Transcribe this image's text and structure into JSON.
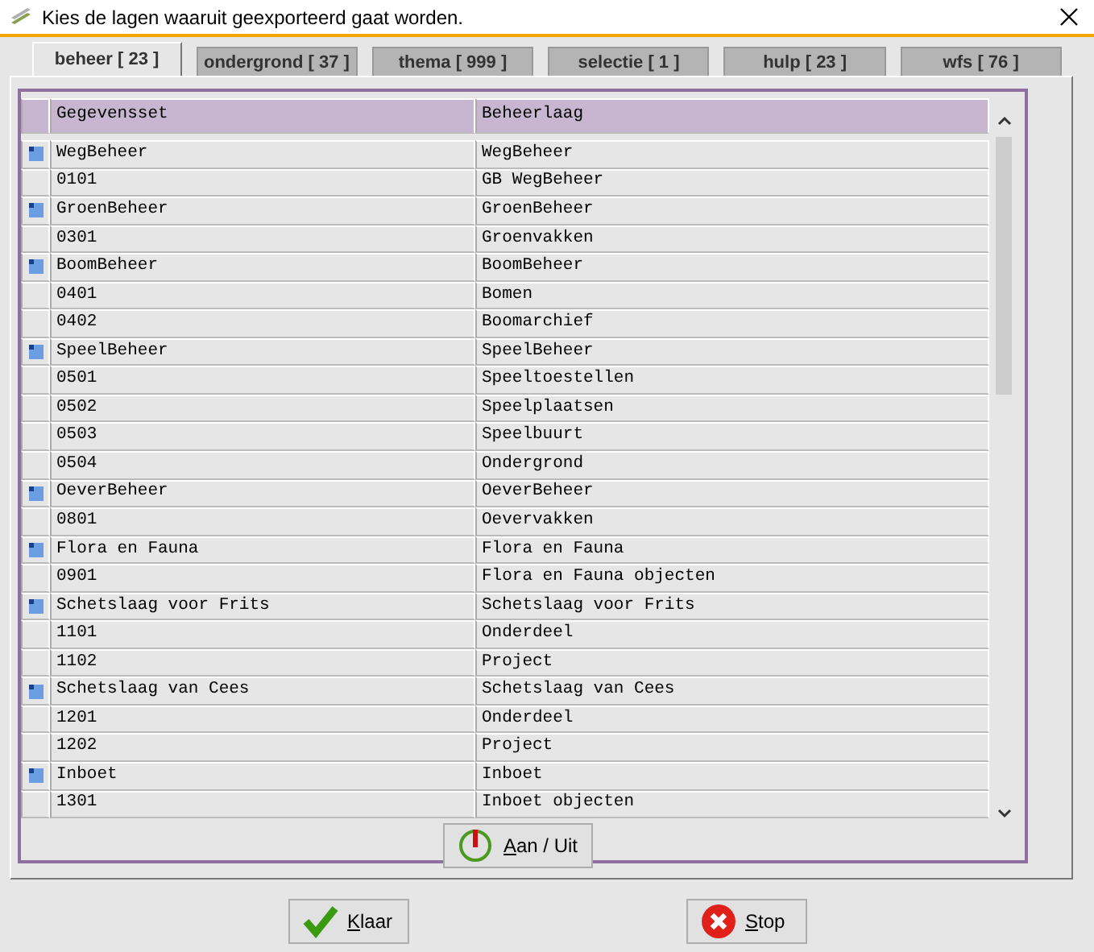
{
  "window": {
    "title": "Kies de lagen waaruit geexporteerd gaat worden."
  },
  "tabs": [
    {
      "label": "beheer [ 23 ]",
      "selected": true
    },
    {
      "label": "ondergrond [ 37 ]",
      "selected": false
    },
    {
      "label": "thema [ 999 ]",
      "selected": false
    },
    {
      "label": "selectie [ 1 ]",
      "selected": false
    },
    {
      "label": "hulp [ 23 ]",
      "selected": false
    },
    {
      "label": "wfs [ 76 ]",
      "selected": false
    }
  ],
  "table": {
    "columns": [
      "Gegevensset",
      "Beheerlaag"
    ],
    "rows": [
      {
        "kind": "group",
        "cells": [
          "WegBeheer",
          "WegBeheer"
        ]
      },
      {
        "kind": "item",
        "cells": [
          "0101",
          "GB WegBeheer"
        ]
      },
      {
        "kind": "group",
        "cells": [
          "GroenBeheer",
          "GroenBeheer"
        ]
      },
      {
        "kind": "item",
        "cells": [
          "0301",
          "Groenvakken"
        ]
      },
      {
        "kind": "group",
        "cells": [
          "BoomBeheer",
          "BoomBeheer"
        ]
      },
      {
        "kind": "item",
        "cells": [
          "0401",
          "Bomen"
        ]
      },
      {
        "kind": "item",
        "cells": [
          "0402",
          "Boomarchief"
        ]
      },
      {
        "kind": "group",
        "cells": [
          "SpeelBeheer",
          "SpeelBeheer"
        ]
      },
      {
        "kind": "item",
        "cells": [
          "0501",
          "Speeltoestellen"
        ]
      },
      {
        "kind": "item",
        "cells": [
          "0502",
          "Speelplaatsen"
        ]
      },
      {
        "kind": "item",
        "cells": [
          "0503",
          "Speelbuurt"
        ]
      },
      {
        "kind": "item",
        "cells": [
          "0504",
          "Ondergrond"
        ]
      },
      {
        "kind": "group",
        "cells": [
          "OeverBeheer",
          "OeverBeheer"
        ]
      },
      {
        "kind": "item",
        "cells": [
          "0801",
          "Oevervakken"
        ]
      },
      {
        "kind": "group",
        "cells": [
          "Flora en Fauna",
          "Flora en Fauna"
        ]
      },
      {
        "kind": "item",
        "cells": [
          "0901",
          "Flora en Fauna objecten"
        ]
      },
      {
        "kind": "group",
        "cells": [
          "Schetslaag voor Frits",
          "Schetslaag voor Frits"
        ]
      },
      {
        "kind": "item",
        "cells": [
          "1101",
          "Onderdeel"
        ]
      },
      {
        "kind": "item",
        "cells": [
          "1102",
          "Project"
        ]
      },
      {
        "kind": "group",
        "cells": [
          "Schetslaag van Cees",
          "Schetslaag van Cees"
        ]
      },
      {
        "kind": "item",
        "cells": [
          "1201",
          "Onderdeel"
        ]
      },
      {
        "kind": "item",
        "cells": [
          "1202",
          "Project"
        ]
      },
      {
        "kind": "group",
        "cells": [
          "Inboet",
          "Inboet"
        ]
      },
      {
        "kind": "item",
        "cells": [
          "1301",
          "Inboet objecten"
        ]
      }
    ]
  },
  "toggle_button": {
    "label": "Aan / Uit",
    "access_key_underlined": true
  },
  "buttons": [
    {
      "kind": "ok",
      "label": "Klaar",
      "access_key_underlined": true
    },
    {
      "kind": "stop",
      "label": "Stop",
      "access_key_underlined": true
    }
  ]
}
